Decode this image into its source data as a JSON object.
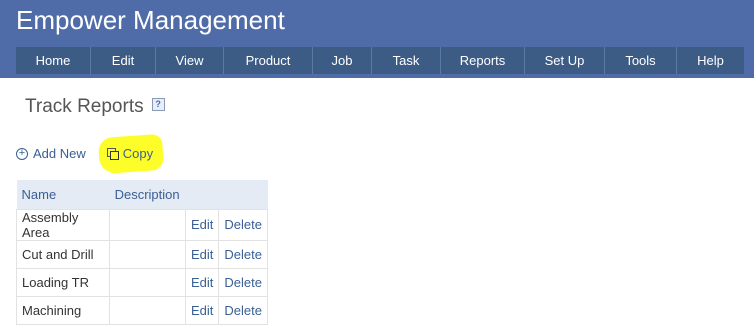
{
  "header": {
    "title": "Empower Management"
  },
  "nav": {
    "items": [
      {
        "label": "Home"
      },
      {
        "label": "Edit"
      },
      {
        "label": "View"
      },
      {
        "label": "Product"
      },
      {
        "label": "Job"
      },
      {
        "label": "Task"
      },
      {
        "label": "Reports"
      },
      {
        "label": "Set Up"
      },
      {
        "label": "Tools"
      },
      {
        "label": "Help"
      }
    ]
  },
  "page": {
    "title": "Track Reports",
    "help_icon": "?"
  },
  "actions": {
    "add_new": "Add New",
    "copy": "Copy",
    "add_icon": "+"
  },
  "table": {
    "headers": {
      "name": "Name",
      "description": "Description"
    },
    "rows": [
      {
        "name": "Assembly Area",
        "description": "",
        "edit": "Edit",
        "delete": "Delete"
      },
      {
        "name": "Cut and Drill",
        "description": "",
        "edit": "Edit",
        "delete": "Delete"
      },
      {
        "name": "Loading TR",
        "description": "",
        "edit": "Edit",
        "delete": "Delete"
      },
      {
        "name": "Machining",
        "description": "",
        "edit": "Edit",
        "delete": "Delete"
      }
    ]
  }
}
